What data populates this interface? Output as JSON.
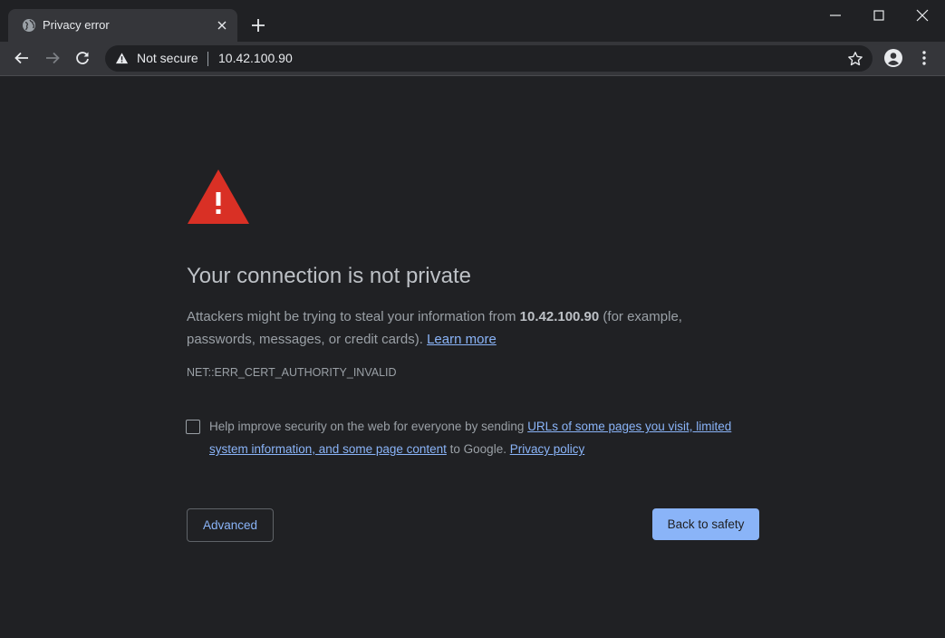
{
  "tab": {
    "title": "Privacy error",
    "favicon": "globe-icon"
  },
  "omnibox": {
    "security_label": "Not secure",
    "url": "10.42.100.90"
  },
  "page": {
    "heading": "Your connection is not private",
    "explanation_before": "Attackers might be trying to steal your information from ",
    "host": "10.42.100.90",
    "explanation_after": " (for example, passwords, messages, or credit cards). ",
    "learn_more": "Learn more",
    "error_code": "NET::ERR_CERT_AUTHORITY_INVALID",
    "optin_before": "Help improve security on the web for everyone by sending ",
    "optin_link": "URLs of some pages you visit, limited system information, and some page content",
    "optin_middle": " to Google. ",
    "privacy_policy": "Privacy policy",
    "checkbox_checked": false,
    "advanced_label": "Advanced",
    "safety_label": "Back to safety"
  },
  "colors": {
    "background": "#202124",
    "toolbar": "#35363a",
    "warning_red": "#d93025",
    "link": "#8ab4f8",
    "primary_button": "#8ab4f8"
  }
}
